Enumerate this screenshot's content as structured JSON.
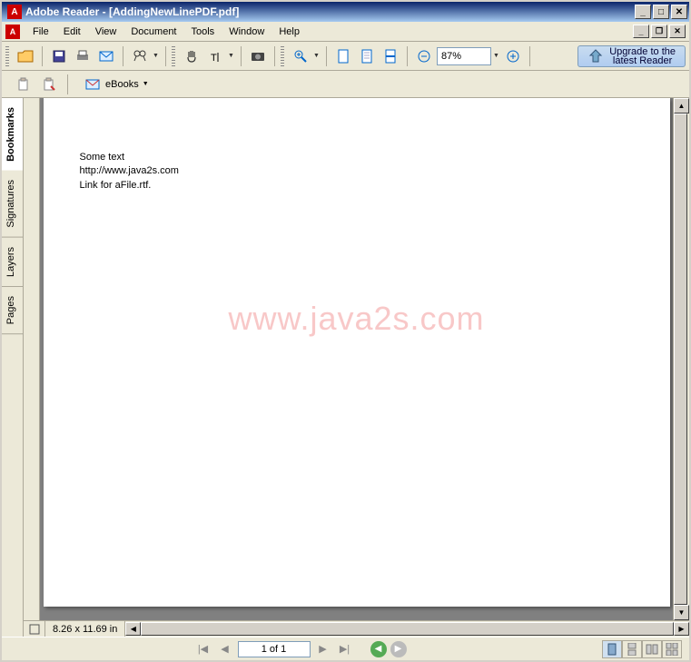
{
  "title": "Adobe Reader - [AddingNewLinePDF.pdf]",
  "menus": [
    "File",
    "Edit",
    "View",
    "Document",
    "Tools",
    "Window",
    "Help"
  ],
  "zoom": "87%",
  "upgrade": "Upgrade to the\nlatest Reader",
  "ebooks_label": "eBooks",
  "side_tabs": [
    "Bookmarks",
    "Signatures",
    "Layers",
    "Pages"
  ],
  "document": {
    "lines": [
      "Some text",
      "http://www.java2s.com",
      "Link for aFile.rtf."
    ],
    "watermark": "www.java2s.com"
  },
  "page_size": "8.26 x 11.69 in",
  "page_indicator": "1 of 1"
}
